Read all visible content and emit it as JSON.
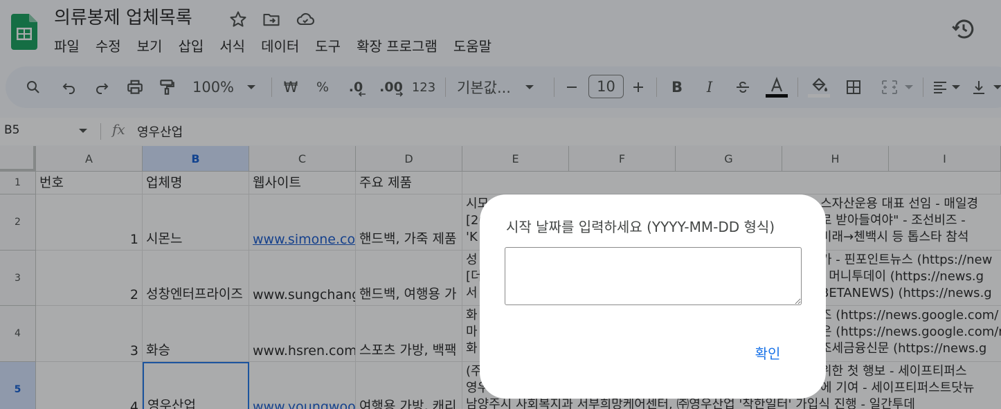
{
  "header": {
    "title": "의류봉제 업체목록",
    "icons": [
      "star-icon",
      "move-to-folder-icon",
      "cloud-saved-icon",
      "version-history-icon"
    ]
  },
  "menu": [
    "파일",
    "수정",
    "보기",
    "삽입",
    "서식",
    "데이터",
    "도구",
    "확장 프로그램",
    "도움말"
  ],
  "toolbar": {
    "zoom": "100%",
    "currency": "₩",
    "percent": "%",
    "decrease_decimal": ".0",
    "increase_decimal": ".00",
    "number_format": "123",
    "font": "기본값...",
    "font_size": "10",
    "bold": "B",
    "italic": "I",
    "text_color_accent": "#000000"
  },
  "formula_bar": {
    "name_box": "B5",
    "fx": "fx",
    "value": "영우산업"
  },
  "columns": [
    "A",
    "B",
    "C",
    "D",
    "E",
    "F",
    "G",
    "H",
    "I"
  ],
  "rows": [
    {
      "num": "1",
      "cells": [
        "번호",
        "업체명",
        "웹사이트",
        "주요 제품"
      ]
    },
    {
      "num": "2",
      "cells": [
        "1",
        "시몬느",
        "www.simone.co.",
        "핸드백, 가죽 제품"
      ],
      "news": [
        "시모",
        "[20",
        "'K"
      ],
      "news_right": [
        "스자산운용 대표 선임 - 매일경",
        "로 받아들여야\" - 조선비즈 - ",
        "미래→첸백시 등 톱스타 참석"
      ]
    },
    {
      "num": "3",
      "cells": [
        "2",
        "성창엔터프라이즈",
        "www.sungchang",
        "핸드백, 여행용 가"
      ],
      "news": [
        "성",
        "[더",
        "서"
      ],
      "news_right": [
        "가 - 핀포인트뉴스 (https://new",
        "- 머니투데이 (https://news.g",
        "BETANEWS) (https://news.g"
      ]
    },
    {
      "num": "4",
      "cells": [
        "3",
        "화승",
        "www.hsren.com",
        "스포츠 가방, 백팩"
      ],
      "news": [
        "화",
        "마",
        "화"
      ],
      "news_right": [
        "즈 (https://news.google.com/",
        "은 (https://news.google.com/r",
        "조세금융신문 (https://news.g"
      ]
    },
    {
      "num": "5",
      "cells": [
        "4",
        "영우산업",
        "www.youngwoo",
        "여행용 가방, 캐리"
      ],
      "news": [
        "(주",
        "영우",
        "남양주시 사회복지과 서부희망케어센터, ㈜영우산업 '착한일터' 가입식 진행 - 일간투데"
      ],
      "news_right": [
        "위한 첫 행보 - 세이프티퍼스",
        "에 기여 - 세이프티퍼스트닷뉴",
        ""
      ]
    }
  ],
  "dialog": {
    "title": "시작 날짜를 입력하세요 (YYYY-MM-DD 형식)",
    "input_value": "",
    "ok_label": "확인"
  },
  "colors": {
    "accent": "#1a73e8",
    "sheets_green": "#0f9d58",
    "toolbar_bg": "#edf2fa",
    "selected_header": "#d3e3fd"
  }
}
